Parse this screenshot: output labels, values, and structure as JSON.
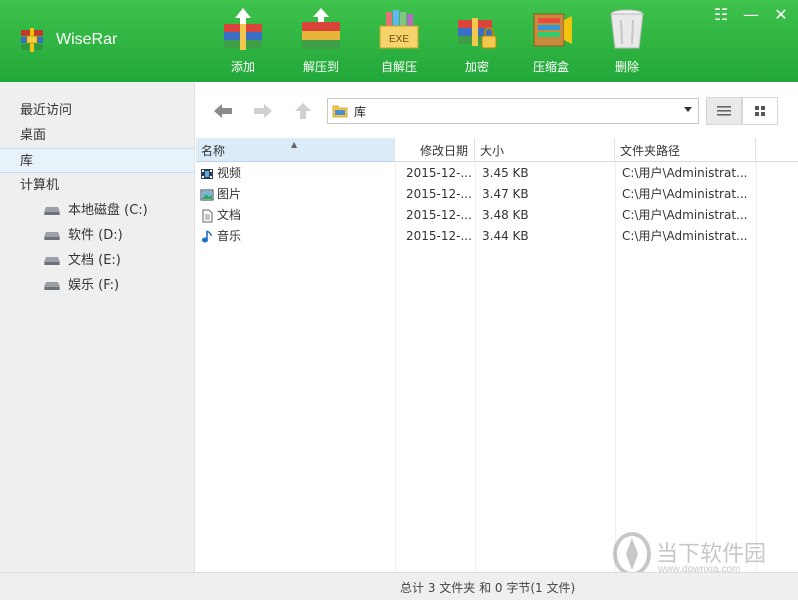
{
  "app": {
    "name": "WiseRar"
  },
  "toolbar": [
    {
      "id": "add",
      "label": "添加",
      "icon": "add-archive-icon"
    },
    {
      "id": "extract",
      "label": "解压到",
      "icon": "extract-archive-icon"
    },
    {
      "id": "sfx",
      "label": "自解压",
      "icon": "self-extract-icon",
      "badge": "EXE"
    },
    {
      "id": "encrypt",
      "label": "加密",
      "icon": "encrypt-icon"
    },
    {
      "id": "compress",
      "label": "压缩盒",
      "icon": "compress-box-icon"
    },
    {
      "id": "delete",
      "label": "删除",
      "icon": "trash-icon"
    }
  ],
  "window": {
    "menu_icon": "☷",
    "minimize": "—",
    "close": "✕"
  },
  "sidebar": {
    "items": [
      {
        "label": "最近访问",
        "selected": false
      },
      {
        "label": "桌面",
        "selected": false
      },
      {
        "label": "库",
        "selected": true
      },
      {
        "label": "计算机",
        "selected": false
      }
    ],
    "drives": [
      {
        "label": "本地磁盘 (C:)"
      },
      {
        "label": "软件 (D:)"
      },
      {
        "label": "文档 (E:)"
      },
      {
        "label": "娱乐 (F:)"
      }
    ]
  },
  "navbar": {
    "path": "库",
    "path_icon": "library-folder-icon"
  },
  "table": {
    "headers": {
      "name": "名称",
      "date": "修改日期",
      "size": "大小",
      "path": "文件夹路径"
    },
    "sort_indicator": "▲",
    "rows": [
      {
        "name": "视频",
        "date": "2015-12-...",
        "size": "3.45 KB",
        "path": "C:\\用户\\Administrat...",
        "icon": "video-library-icon"
      },
      {
        "name": "图片",
        "date": "2015-12-...",
        "size": "3.47 KB",
        "path": "C:\\用户\\Administrat...",
        "icon": "picture-library-icon"
      },
      {
        "name": "文档",
        "date": "2015-12-...",
        "size": "3.48 KB",
        "path": "C:\\用户\\Administrat...",
        "icon": "document-library-icon"
      },
      {
        "name": "音乐",
        "date": "2015-12-...",
        "size": "3.44 KB",
        "path": "C:\\用户\\Administrat...",
        "icon": "music-library-icon"
      }
    ]
  },
  "status": {
    "text": "总计 3 文件夹  和  0 字节(1 文件)"
  },
  "watermark": {
    "title": "当下软件园",
    "url": "www.downxia.com"
  },
  "colors": {
    "header_green": "#2eb341",
    "selection_blue": "#dcebf8"
  }
}
